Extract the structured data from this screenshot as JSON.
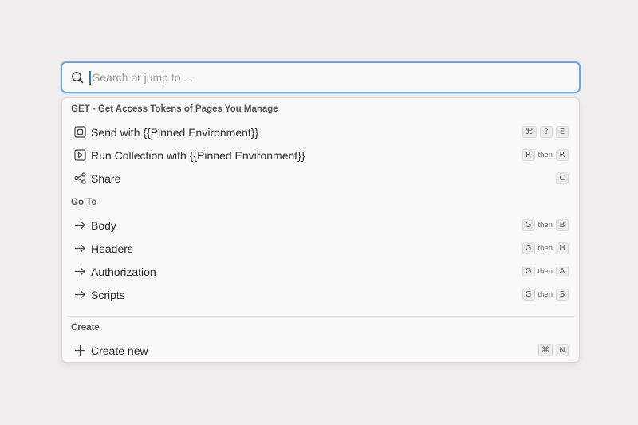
{
  "search": {
    "placeholder": "Search or jump to ...",
    "value": ""
  },
  "sections": {
    "request": {
      "title": "GET - Get Access Tokens of Pages You Manage",
      "items": [
        {
          "label": "Send with {{Pinned Environment}}",
          "icon": "send-square-icon",
          "shortcut": [
            "⌘",
            "⇧",
            "E"
          ]
        },
        {
          "label": "Run Collection with {{Pinned Environment}}",
          "icon": "play-square-icon",
          "shortcut": [
            "R",
            "then",
            "R"
          ]
        },
        {
          "label": "Share",
          "icon": "share-icon",
          "shortcut": [
            "C"
          ]
        }
      ]
    },
    "goto": {
      "title": "Go To",
      "items": [
        {
          "label": "Body",
          "icon": "arrow-right-icon",
          "shortcut": [
            "G",
            "then",
            "B"
          ]
        },
        {
          "label": "Headers",
          "icon": "arrow-right-icon",
          "shortcut": [
            "G",
            "then",
            "H"
          ]
        },
        {
          "label": "Authorization",
          "icon": "arrow-right-icon",
          "shortcut": [
            "G",
            "then",
            "A"
          ]
        },
        {
          "label": "Scripts",
          "icon": "arrow-right-icon",
          "shortcut": [
            "G",
            "then",
            "S"
          ]
        }
      ]
    },
    "create": {
      "title": "Create",
      "items": [
        {
          "label": "Create new",
          "icon": "plus-icon",
          "shortcut": [
            "⌘",
            "N"
          ]
        }
      ]
    }
  },
  "colors": {
    "focus_border": "#6aa3e6",
    "background": "#efedee",
    "panel": "#fafafa"
  }
}
